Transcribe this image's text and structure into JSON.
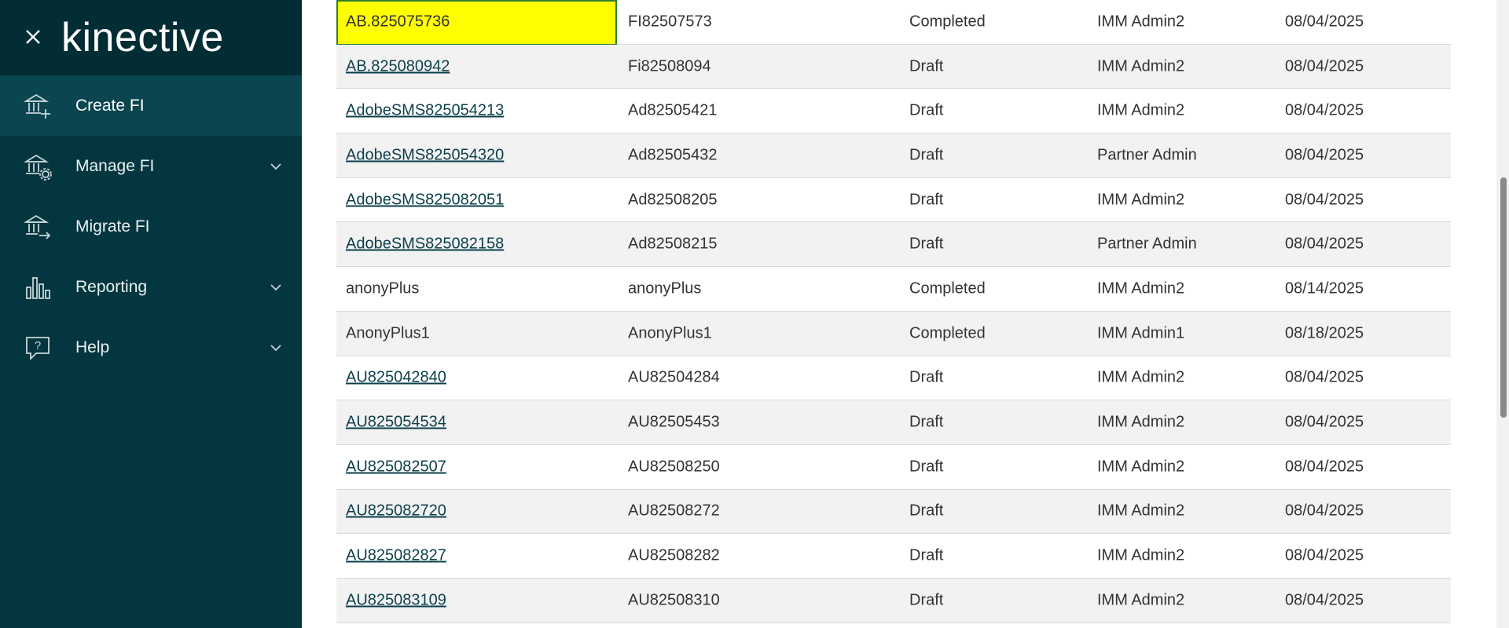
{
  "sidebar": {
    "logo": "kinective",
    "items": [
      {
        "label": "Create FI",
        "icon": "bank-add-icon",
        "active": true
      },
      {
        "label": "Manage FI",
        "icon": "bank-gear-icon",
        "expandable": true
      },
      {
        "label": "Migrate FI",
        "icon": "bank-arrow-icon"
      },
      {
        "label": "Reporting",
        "icon": "bar-chart-icon",
        "expandable": true
      },
      {
        "label": "Help",
        "icon": "help-bubble-icon",
        "expandable": true
      }
    ]
  },
  "table": {
    "rows": [
      {
        "name": "AB.825075736",
        "code": "FI82507573",
        "status": "Completed",
        "user": "IMM Admin2",
        "date": "08/04/2025",
        "link": false,
        "selected": true
      },
      {
        "name": "AB.825080942",
        "code": "Fi82508094",
        "status": "Draft",
        "user": "IMM Admin2",
        "date": "08/04/2025",
        "link": true
      },
      {
        "name": "AdobeSMS825054213",
        "code": "Ad82505421",
        "status": "Draft",
        "user": "IMM Admin2",
        "date": "08/04/2025",
        "link": true
      },
      {
        "name": "AdobeSMS825054320",
        "code": "Ad82505432",
        "status": "Draft",
        "user": "Partner Admin",
        "date": "08/04/2025",
        "link": true
      },
      {
        "name": "AdobeSMS825082051",
        "code": "Ad82508205",
        "status": "Draft",
        "user": "IMM Admin2",
        "date": "08/04/2025",
        "link": true
      },
      {
        "name": "AdobeSMS825082158",
        "code": "Ad82508215",
        "status": "Draft",
        "user": "Partner Admin",
        "date": "08/04/2025",
        "link": true
      },
      {
        "name": "anonyPlus",
        "code": "anonyPlus",
        "status": "Completed",
        "user": "IMM Admin2",
        "date": "08/14/2025",
        "link": false
      },
      {
        "name": "AnonyPlus1",
        "code": "AnonyPlus1",
        "status": "Completed",
        "user": "IMM Admin1",
        "date": "08/18/2025",
        "link": false
      },
      {
        "name": "AU825042840",
        "code": "AU82504284",
        "status": "Draft",
        "user": "IMM Admin2",
        "date": "08/04/2025",
        "link": true
      },
      {
        "name": "AU825054534",
        "code": "AU82505453",
        "status": "Draft",
        "user": "IMM Admin2",
        "date": "08/04/2025",
        "link": true
      },
      {
        "name": "AU825082507",
        "code": "AU82508250",
        "status": "Draft",
        "user": "IMM Admin2",
        "date": "08/04/2025",
        "link": true
      },
      {
        "name": "AU825082720",
        "code": "AU82508272",
        "status": "Draft",
        "user": "IMM Admin2",
        "date": "08/04/2025",
        "link": true
      },
      {
        "name": "AU825082827",
        "code": "AU82508282",
        "status": "Draft",
        "user": "IMM Admin2",
        "date": "08/04/2025",
        "link": true
      },
      {
        "name": "AU825083109",
        "code": "AU82508310",
        "status": "Draft",
        "user": "IMM Admin2",
        "date": "08/04/2025",
        "link": true
      }
    ]
  },
  "colors": {
    "sidebar_bg": "#04363f",
    "highlight": "#ffff00",
    "link": "#0b3f4b"
  }
}
